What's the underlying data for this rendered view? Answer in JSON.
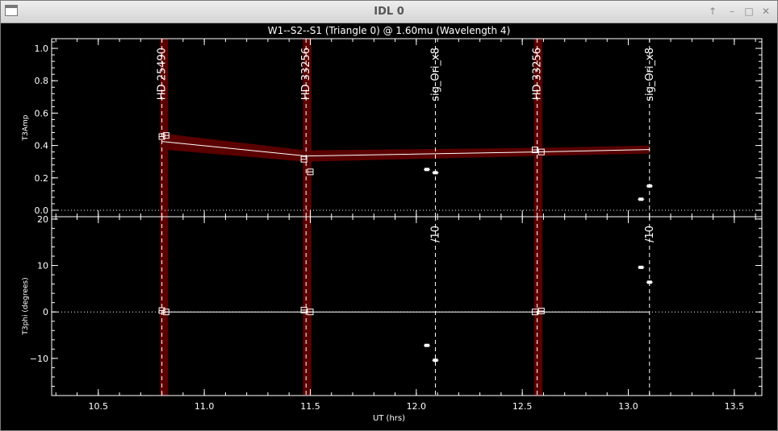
{
  "window": {
    "title": "IDL 0",
    "buttons": [
      "↑",
      "–",
      "□",
      "✕"
    ]
  },
  "chart_data": {
    "type": "scatter",
    "title": "W1--S2--S1 (Triangle 0) @ 1.60mu (Wavelength 4)",
    "xlabel": "UT (hrs)",
    "xlim": [
      10.28,
      13.63
    ],
    "xticks": [
      10.5,
      11.0,
      11.5,
      12.0,
      12.5,
      13.0,
      13.5
    ],
    "xtick_labels": [
      "10.5",
      "11.0",
      "11.5",
      "12.0",
      "12.5",
      "13.0",
      "13.5"
    ],
    "colors": {
      "calibrator_band": "#5a0000",
      "line": "#ffffff",
      "background": "#000000"
    },
    "panels": [
      {
        "name": "t3amp",
        "ylabel": "T3Amp",
        "ylim": [
          -0.04,
          1.06
        ],
        "yticks": [
          0.0,
          0.2,
          0.4,
          0.6,
          0.8,
          1.0
        ],
        "ytick_labels": [
          "0.0",
          "0.2",
          "0.4",
          "0.6",
          "0.8",
          "1.0"
        ],
        "calibrators": [
          {
            "x": 10.8,
            "y": 0.455,
            "x2": 10.82,
            "y2": 0.462
          },
          {
            "x": 11.47,
            "y": 0.315,
            "x2": 11.5,
            "y2": 0.237
          },
          {
            "x": 12.56,
            "y": 0.373,
            "x2": 12.59,
            "y2": 0.36
          }
        ],
        "calibrator_band_width": 0.04,
        "transfer_function": {
          "x": [
            10.8,
            11.48,
            12.57,
            13.1
          ],
          "y": [
            0.425,
            0.335,
            0.36,
            0.375
          ],
          "band_halfwidth": [
            0.05,
            0.035,
            0.025,
            0.025
          ]
        },
        "targets": [
          {
            "x": 12.05,
            "y": 0.252
          },
          {
            "x": 12.09,
            "y": 0.232
          },
          {
            "x": 13.06,
            "y": 0.068
          },
          {
            "x": 13.1,
            "y": 0.15
          }
        ]
      },
      {
        "name": "t3phi",
        "ylabel": "T3phi (degrees)",
        "ylim": [
          -18.0,
          20.5
        ],
        "yticks": [
          -10,
          0,
          10,
          20
        ],
        "ytick_labels": [
          "−10",
          "0",
          "10",
          "20"
        ],
        "calibrators": [
          {
            "x": 10.8,
            "y": 0.3,
            "x2": 10.82,
            "y2": 0.0
          },
          {
            "x": 11.47,
            "y": 0.4,
            "x2": 11.5,
            "y2": 0.0
          },
          {
            "x": 12.56,
            "y": 0.0,
            "x2": 12.59,
            "y2": 0.2
          }
        ],
        "calibrator_band_width": 0.04,
        "transfer_function": {
          "x": [
            10.8,
            13.1
          ],
          "y": [
            0,
            0
          ]
        },
        "targets": [
          {
            "x": 12.05,
            "y": -7.2
          },
          {
            "x": 12.09,
            "y": -10.4
          },
          {
            "x": 13.06,
            "y": 9.6
          },
          {
            "x": 13.1,
            "y": 6.4
          }
        ]
      }
    ],
    "markers": [
      {
        "x": 10.8,
        "label": "HD 25490",
        "phi_label": ""
      },
      {
        "x": 11.48,
        "label": "HD 33256",
        "phi_label": ""
      },
      {
        "x": 12.09,
        "label": "sig_Ori_x8",
        "phi_label": "/10"
      },
      {
        "x": 12.57,
        "label": "HD 33256",
        "phi_label": ""
      },
      {
        "x": 13.1,
        "label": "sig_Ori_x8",
        "phi_label": "/10"
      }
    ]
  }
}
